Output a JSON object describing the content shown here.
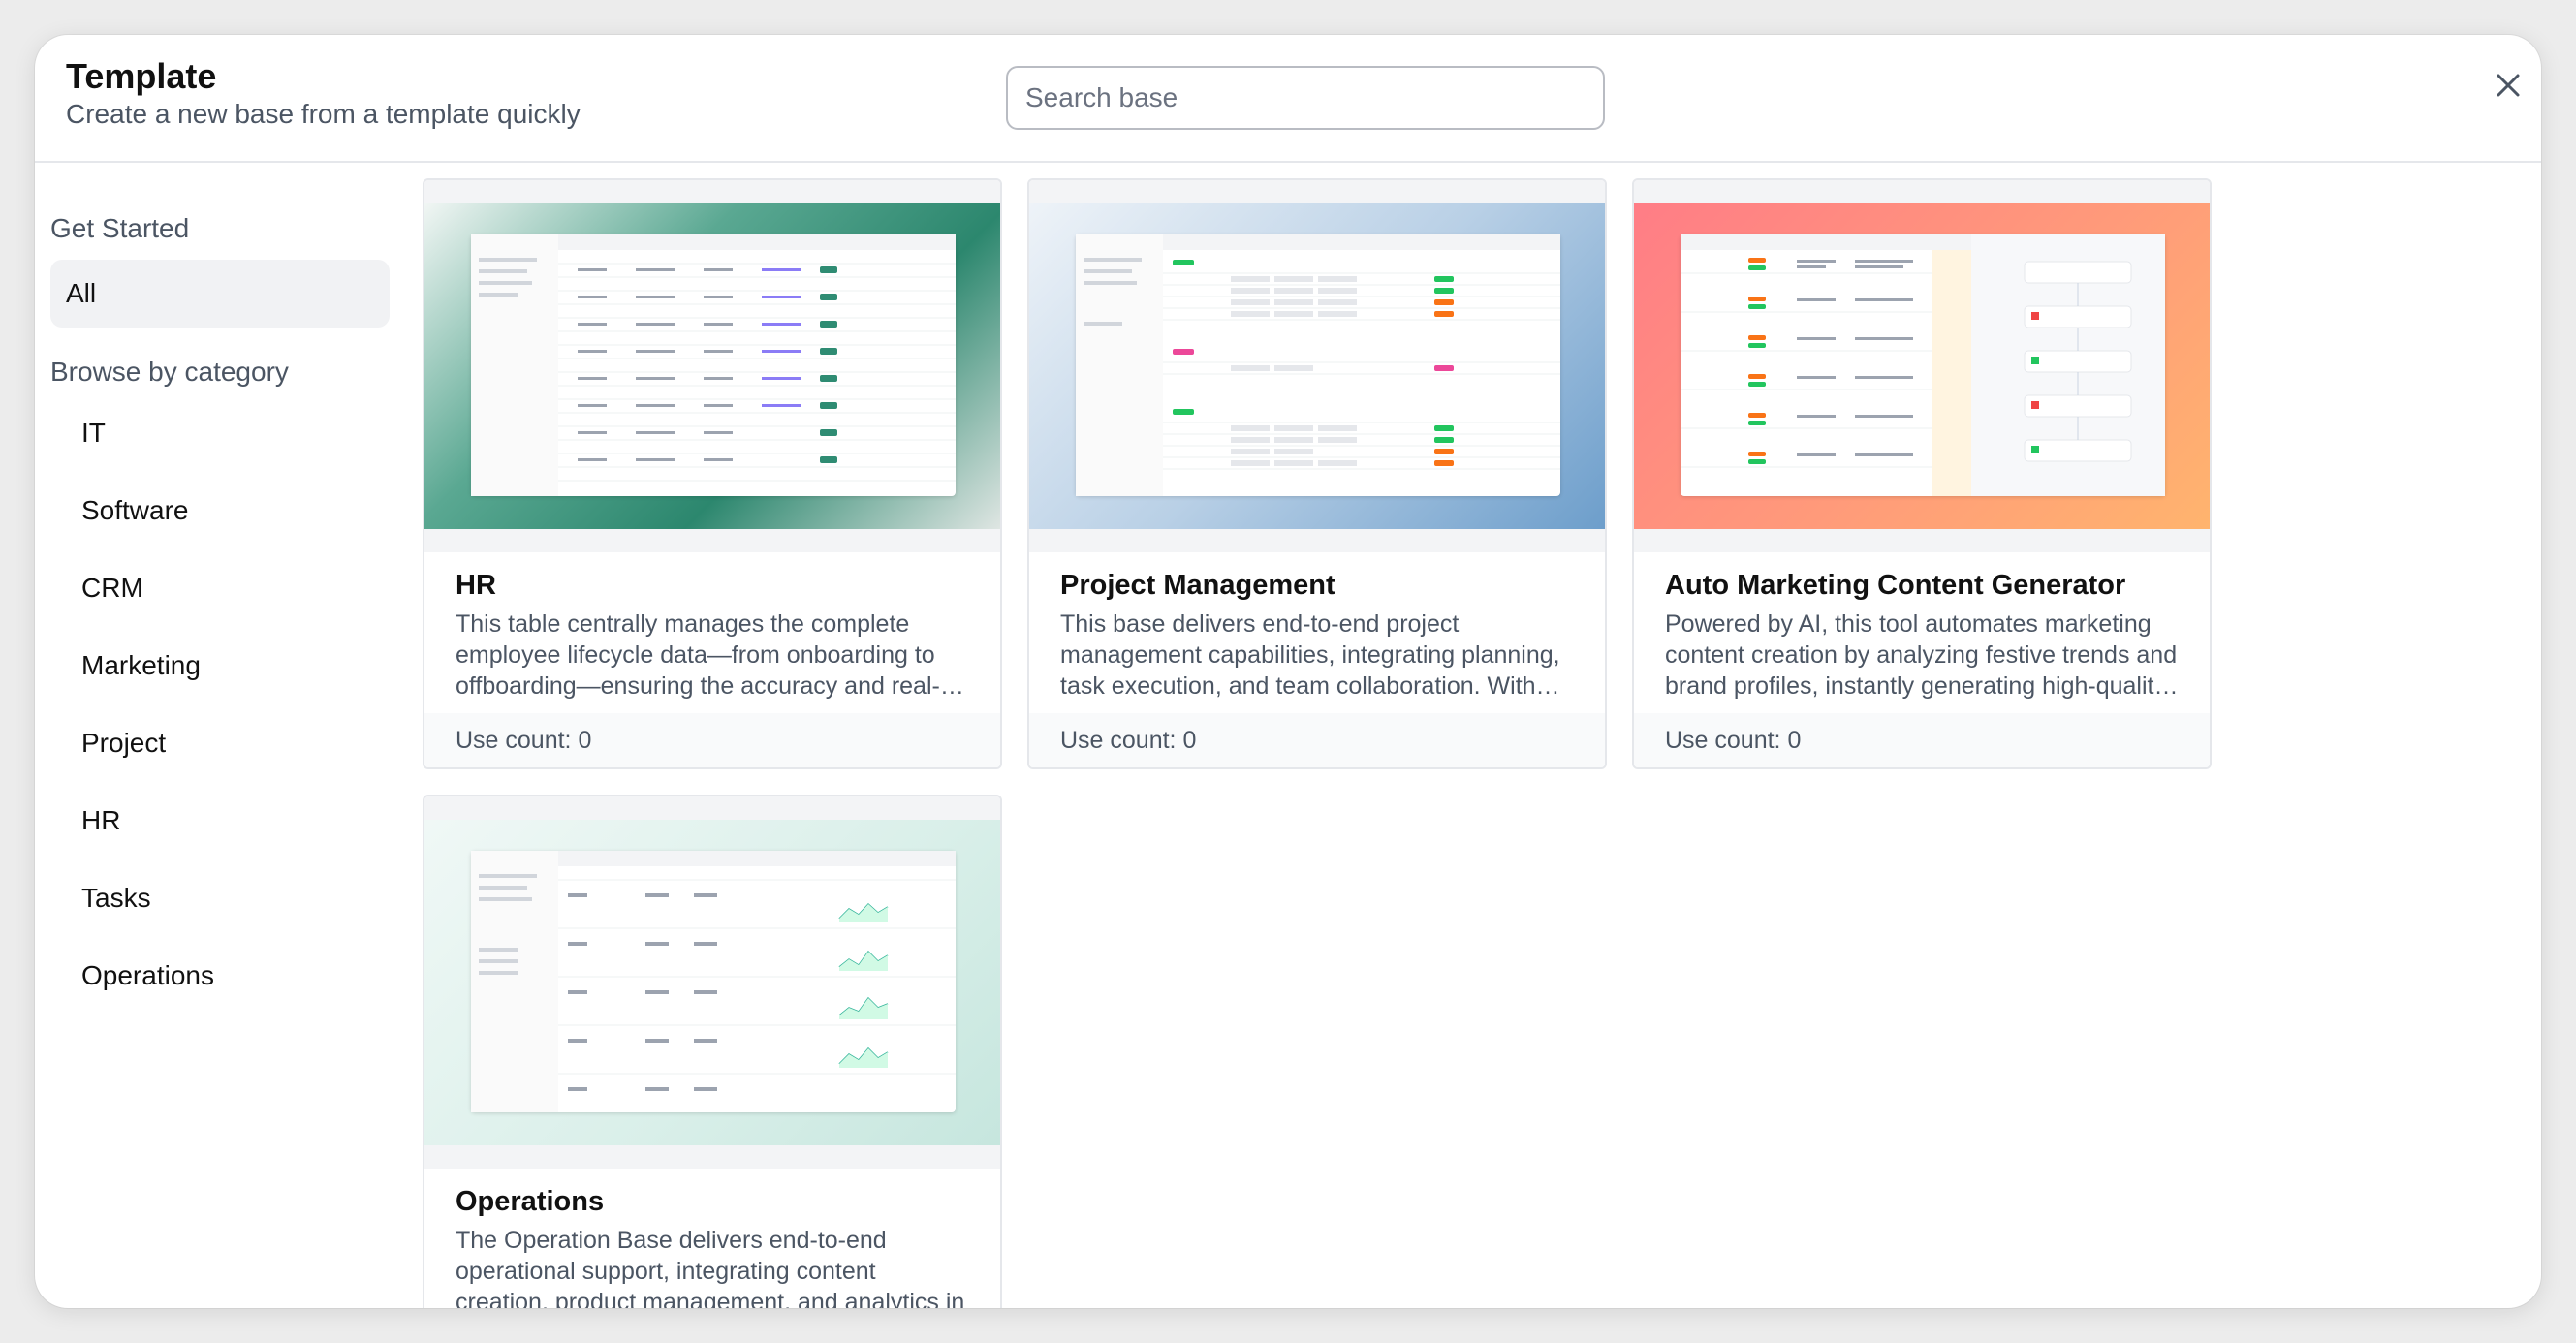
{
  "header": {
    "title": "Template",
    "subtitle": "Create a new base from a template quickly",
    "search_placeholder": "Search base"
  },
  "sidebar": {
    "get_started_heading": "Get Started",
    "all_label": "All",
    "browse_heading": "Browse by category",
    "categories": [
      "IT",
      "Software",
      "CRM",
      "Marketing",
      "Project",
      "HR",
      "Tasks",
      "Operations"
    ]
  },
  "cards": [
    {
      "title": "HR",
      "description": "This table centrally manages the complete employee lifecycle data—from onboarding to offboarding—ensuring the accuracy and real-time availability of employee records.",
      "use_count": "Use count: 0"
    },
    {
      "title": "Project Management",
      "description": "This base delivers end-to-end project management capabilities, integrating planning, task execution, and team collaboration. With real-time tracking and resource allocation.",
      "use_count": "Use count: 0"
    },
    {
      "title": "Auto Marketing Content Generator",
      "description": "Powered by AI, this tool automates marketing content creation by analyzing festive trends and brand profiles, instantly generating high-quality, campaign-ready copy.",
      "use_count": "Use count: 0"
    },
    {
      "title": "Operations",
      "description": "The Operation Base delivers end-to-end operational support, integrating content creation, product management, and analytics in one place.",
      "use_count": ""
    }
  ],
  "colors": {
    "hr_thumb": [
      "#e9f2ef",
      "#2f8c73"
    ],
    "pm_thumb": [
      "#e7eef6",
      "#6b9ccb"
    ],
    "mkt_thumb": [
      "#ff8a8a",
      "#ffb070"
    ],
    "ops_thumb": [
      "#eaf5f2",
      "#cde9e2"
    ]
  }
}
